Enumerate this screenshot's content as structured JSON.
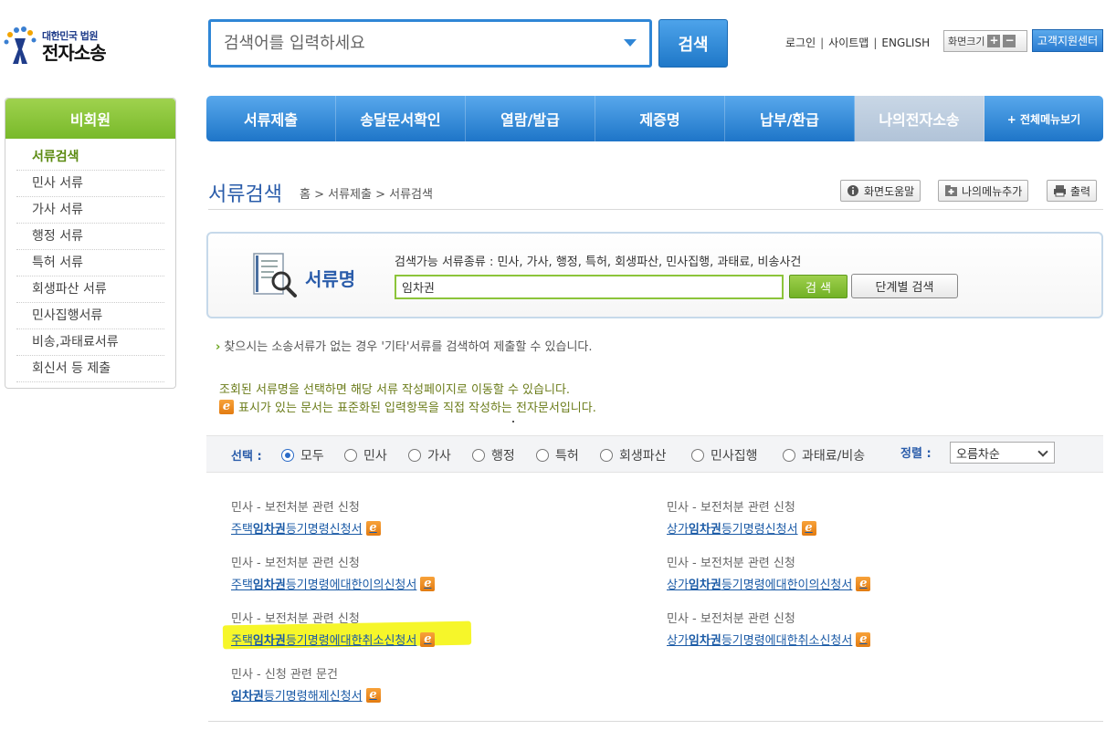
{
  "header": {
    "logo_small": "대한민국 법원",
    "logo_big": "전자소송",
    "search_placeholder": "검색어를 입력하세요",
    "search_button": "검색",
    "links": [
      "로그인",
      "사이트맵",
      "ENGLISH"
    ],
    "fontsize_label": "화면크기",
    "fontsize_plus": "+",
    "fontsize_minus": "−",
    "help_center": "고객지원센터"
  },
  "sidebar": {
    "title": "비회원",
    "items": [
      "서류검색",
      "민사 서류",
      "가사 서류",
      "행정 서류",
      "특허 서류",
      "회생파산 서류",
      "민사집행서류",
      "비송,과태료서류",
      "회신서 등 제출"
    ]
  },
  "nav": {
    "items": [
      "서류제출",
      "송달문서확인",
      "열람/발급",
      "제증명",
      "납부/환급",
      "나의전자소송"
    ],
    "all_menu": "+ 전체메뉴보기"
  },
  "page": {
    "title": "서류검색",
    "breadcrumb": "홈 > 서류제출 > 서류검색",
    "help_btn": "화면도움말",
    "add_menu_btn": "나의메뉴추가",
    "print_btn": "출력"
  },
  "doc_search": {
    "label": "서류명",
    "types": "검색가능 서류종류 : 민사, 가사, 행정, 특허, 회생파산, 민사집행, 과태료, 비송사건",
    "value": "임차권",
    "search_btn": "검 색",
    "step_btn": "단계별 검색"
  },
  "notices": {
    "other": "찾으시는 소송서류가 없는 경우 '기타'서류를 검색하여 제출할 수 있습니다.",
    "select": "조회된 서류명을 선택하면 해당 서류 작성페이지로 이동할 수 있습니다.",
    "ebadge": "표시가 있는 문서는 표준화된 입력항목을 직접 작성하는 전자문서입니다.",
    "e": "e"
  },
  "filter": {
    "label": "선택 :",
    "options": [
      "모두",
      "민사",
      "가사",
      "행정",
      "특허",
      "회생파산",
      "민사집행",
      "과태료/비송"
    ],
    "selected": "모두",
    "sort_label": "정렬 :",
    "sort_value": "오름차순"
  },
  "results": [
    {
      "category": "민사 - 보전처분 관련 신청",
      "pre": "주택",
      "kw": "임차권",
      "post": "등기명령신청서"
    },
    {
      "category": "민사 - 보전처분 관련 신청",
      "pre": "상가",
      "kw": "임차권",
      "post": "등기명령신청서"
    },
    {
      "category": "민사 - 보전처분 관련 신청",
      "pre": "주택",
      "kw": "임차권",
      "post": "등기명령에대한이의신청서"
    },
    {
      "category": "민사 - 보전처분 관련 신청",
      "pre": "상가",
      "kw": "임차권",
      "post": "등기명령에대한이의신청서"
    },
    {
      "category": "민사 - 보전처분 관련 신청",
      "pre": "주택",
      "kw": "임차권",
      "post": "등기명령에대한취소신청서"
    },
    {
      "category": "민사 - 보전처분 관련 신청",
      "pre": "상가",
      "kw": "임차권",
      "post": "등기명령에대한취소신청서"
    },
    {
      "category": "민사 - 신청 관련 문건",
      "pre": "",
      "kw": "임차권",
      "post": "등기명령해제신청서"
    }
  ]
}
